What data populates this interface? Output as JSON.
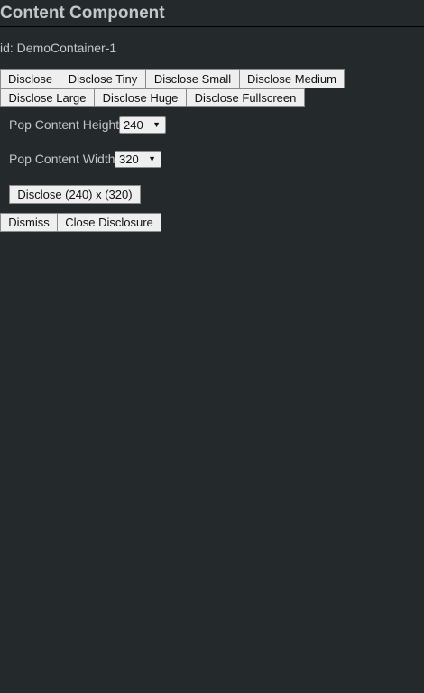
{
  "header": {
    "title": "Content Component"
  },
  "container": {
    "id_label": "id: DemoContainer-1"
  },
  "disclose_buttons": {
    "disclose": "Disclose",
    "tiny": "Disclose Tiny",
    "small": "Disclose Small",
    "medium": "Disclose Medium",
    "large": "Disclose Large",
    "huge": "Disclose Huge",
    "fullscreen": "Disclose Fullscreen"
  },
  "height_control": {
    "label": "Pop Content Height",
    "selected": "240"
  },
  "width_control": {
    "label": "Pop Content Width",
    "selected": "320"
  },
  "custom_disclose": {
    "label": "Disclose (240) x (320)"
  },
  "actions": {
    "dismiss": "Dismiss",
    "close": "Close Disclosure"
  },
  "icons": {
    "dropdown": "chevron-down-icon"
  }
}
